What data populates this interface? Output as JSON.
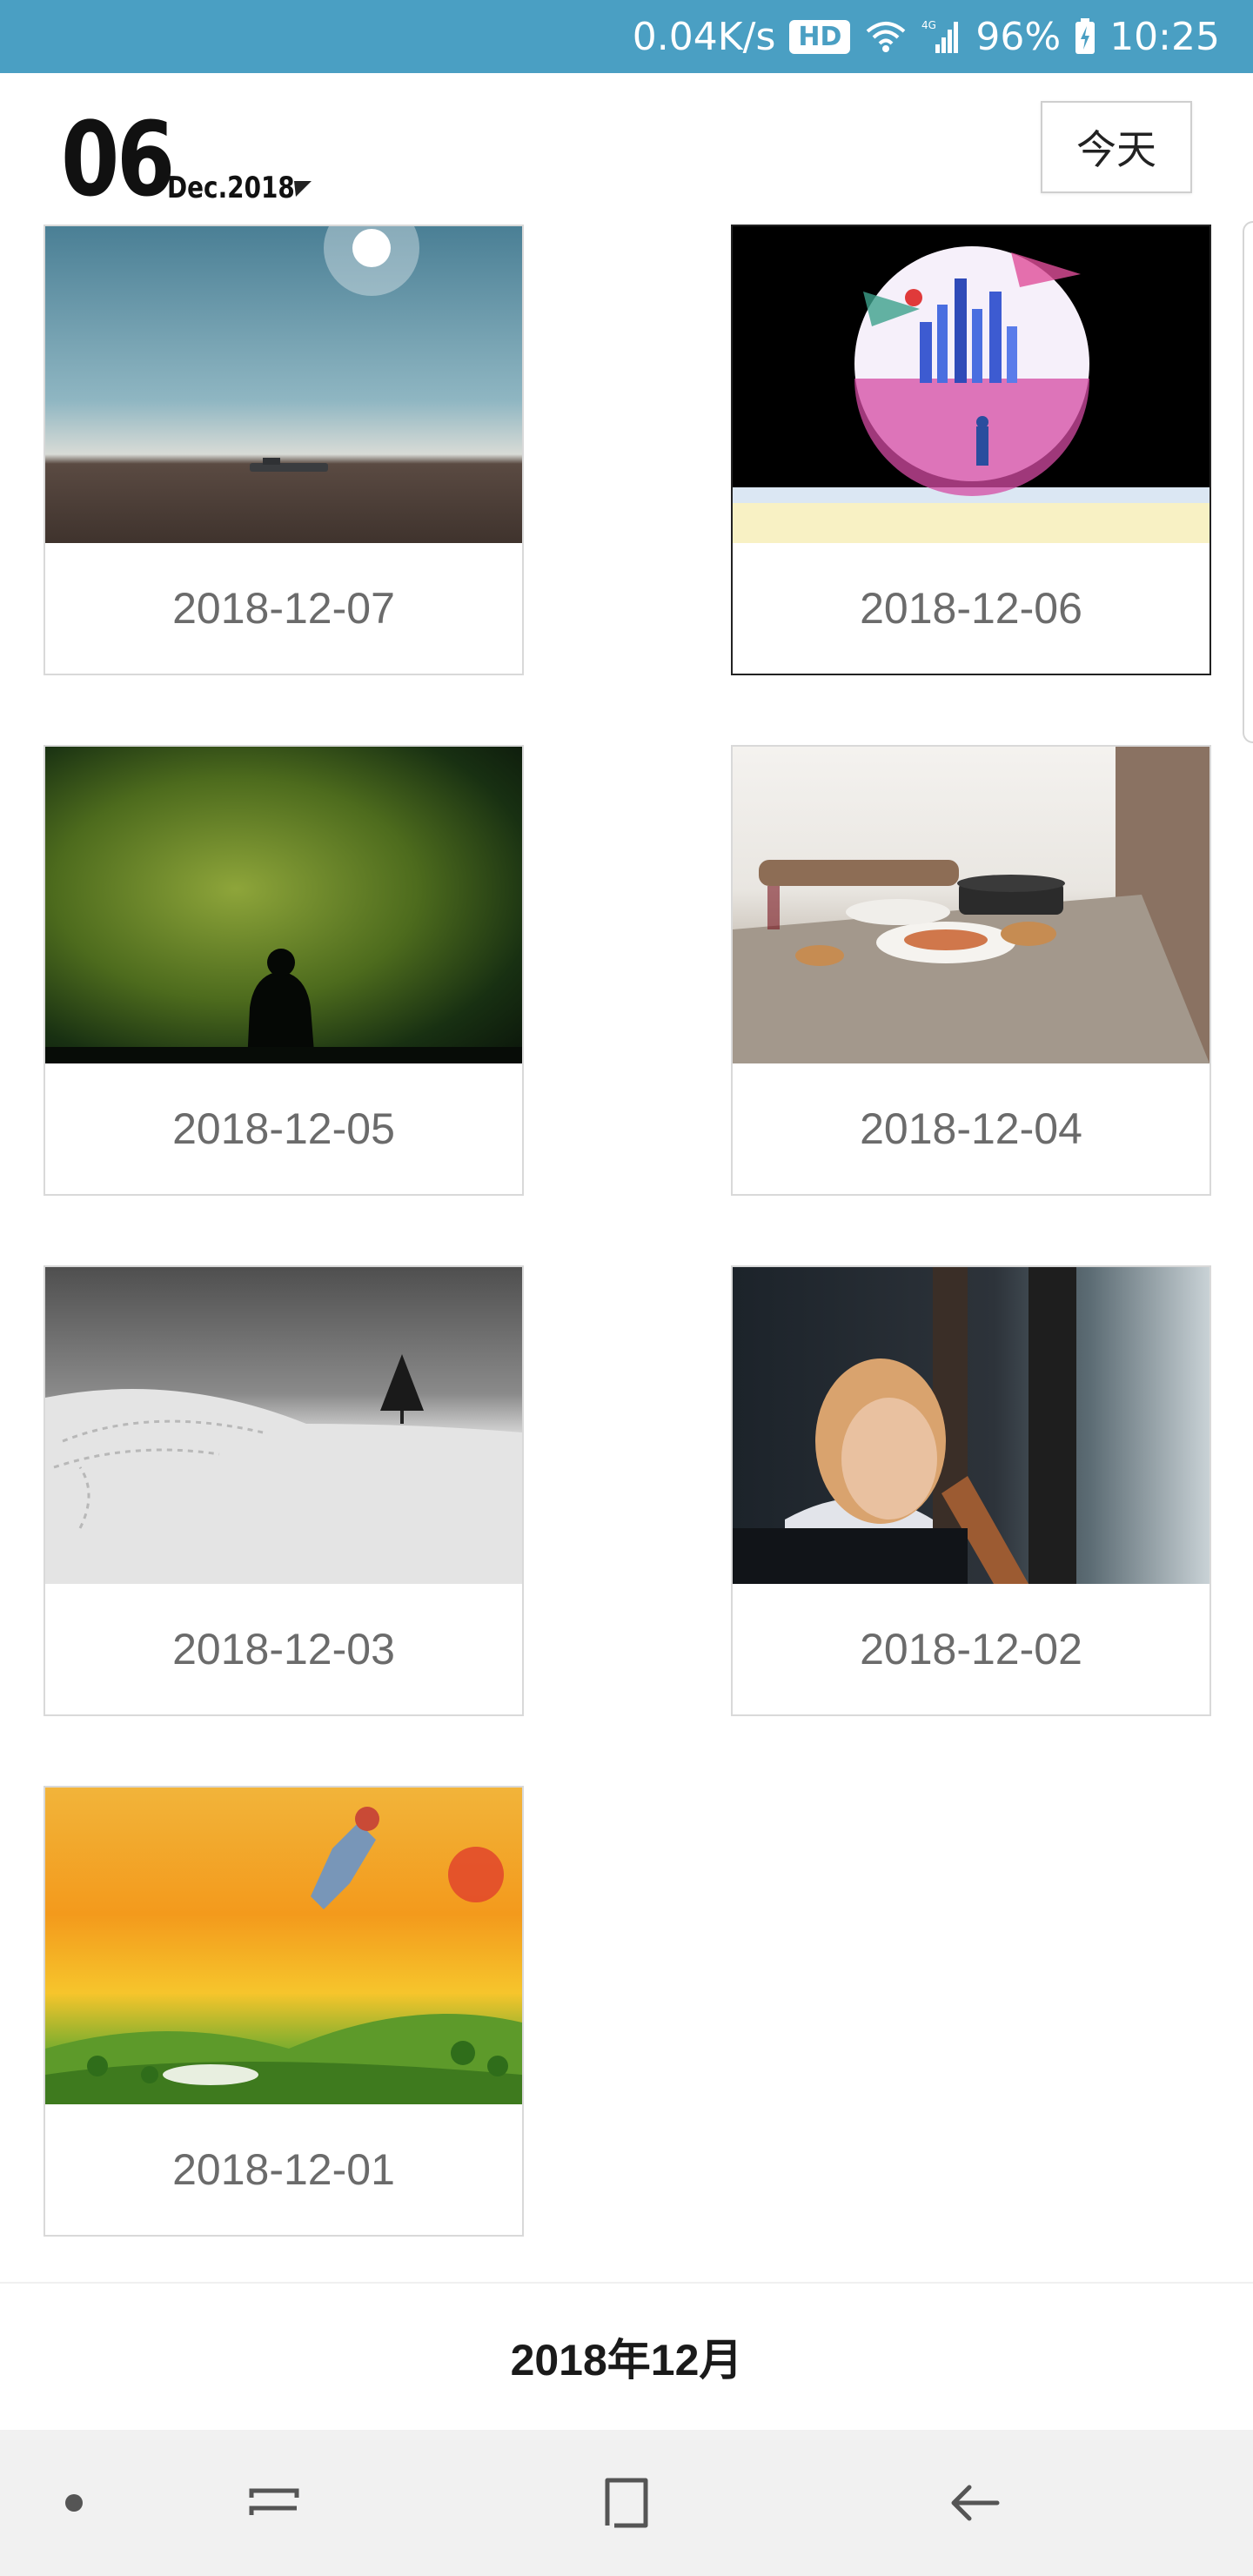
{
  "status_bar": {
    "network_speed": "0.04K/s",
    "hd_badge": "HD",
    "signal_label": "4G",
    "battery": "96%",
    "time": "10:25"
  },
  "header": {
    "day": "06",
    "month_year": "Dec.2018",
    "today_label": "今天"
  },
  "cards": [
    {
      "date": "2018-12-07",
      "selected": false
    },
    {
      "date": "2018-12-06",
      "selected": true
    },
    {
      "date": "2018-12-05",
      "selected": false
    },
    {
      "date": "2018-12-04",
      "selected": false
    },
    {
      "date": "2018-12-03",
      "selected": false
    },
    {
      "date": "2018-12-02",
      "selected": false
    },
    {
      "date": "2018-12-01",
      "selected": false
    }
  ],
  "footer": {
    "month_label": "2018年12月"
  },
  "colors": {
    "status_bar": "#4a9fc3",
    "background": "#ffffff",
    "card_border": "#d9d9d9",
    "card_selected_border": "#222222",
    "date_text": "#6b6b6b",
    "nav_bar": "#f1f1f1"
  },
  "icons": {
    "wifi": "wifi-icon",
    "signal": "signal-icon",
    "battery": "battery-charging-icon",
    "dropdown": "triangle-down-icon",
    "nav_dot": "dot-icon",
    "nav_recents": "recents-icon",
    "nav_home": "home-icon",
    "nav_back": "back-icon"
  }
}
